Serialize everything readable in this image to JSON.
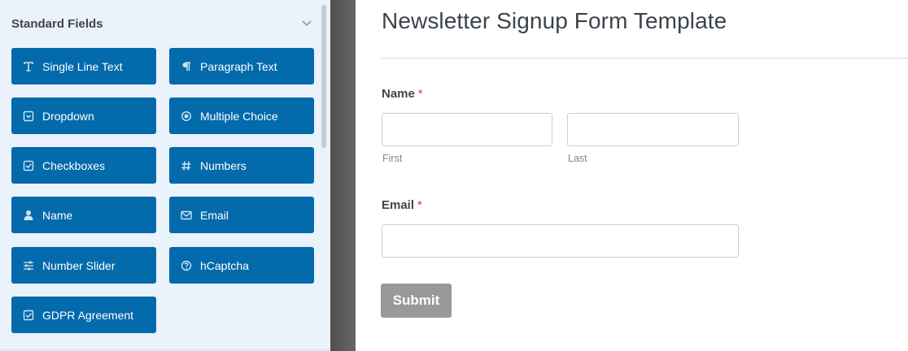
{
  "sidebar": {
    "section_title": "Standard Fields",
    "fields": [
      {
        "label": "Single Line Text",
        "icon": "text-icon"
      },
      {
        "label": "Paragraph Text",
        "icon": "paragraph-icon"
      },
      {
        "label": "Dropdown",
        "icon": "dropdown-icon"
      },
      {
        "label": "Multiple Choice",
        "icon": "radio-icon"
      },
      {
        "label": "Checkboxes",
        "icon": "checkbox-icon"
      },
      {
        "label": "Numbers",
        "icon": "hash-icon"
      },
      {
        "label": "Name",
        "icon": "user-icon"
      },
      {
        "label": "Email",
        "icon": "envelope-icon"
      },
      {
        "label": "Number Slider",
        "icon": "sliders-icon"
      },
      {
        "label": "hCaptcha",
        "icon": "question-circle-icon"
      },
      {
        "label": "GDPR Agreement",
        "icon": "checkbox-icon"
      }
    ]
  },
  "form": {
    "title": "Newsletter Signup Form Template",
    "name_label": "Name",
    "required_mark": "*",
    "first_sublabel": "First",
    "last_sublabel": "Last",
    "email_label": "Email",
    "submit_label": "Submit"
  },
  "colors": {
    "button_blue": "#036aab",
    "sidebar_bg": "#eaf2fb",
    "required_red": "#d63638",
    "submit_gray": "#999999"
  }
}
